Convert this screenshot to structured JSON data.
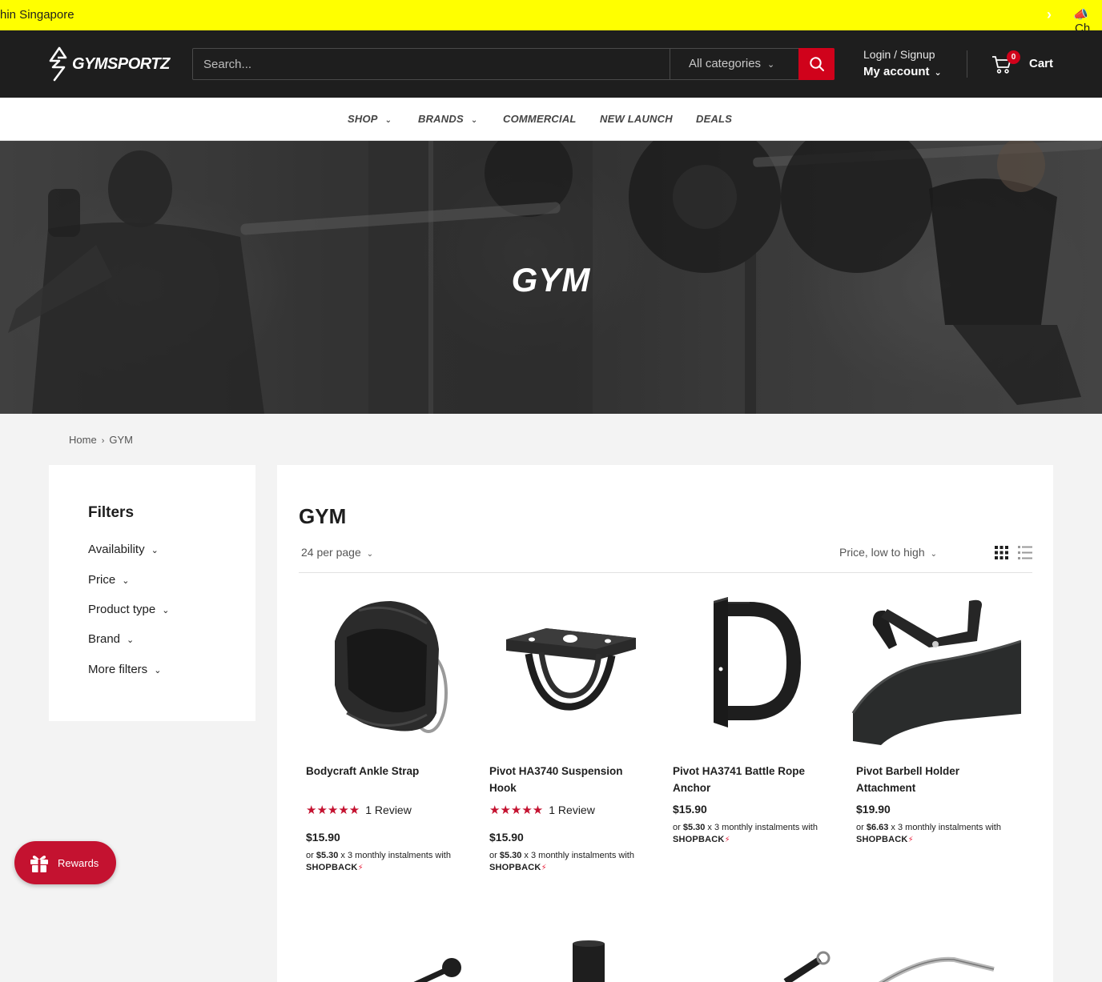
{
  "announcement": {
    "text": "hin Singapore",
    "next_label": "›",
    "right_text": "Ch"
  },
  "header": {
    "logo_text": "GYMSPORTZ",
    "search_placeholder": "Search...",
    "category_select": "All categories",
    "account_line1": "Login / Signup",
    "account_line2": "My account",
    "cart_count": "0",
    "cart_label": "Cart"
  },
  "nav": [
    {
      "label": "SHOP",
      "has_dropdown": true
    },
    {
      "label": "BRANDS",
      "has_dropdown": true
    },
    {
      "label": "COMMERCIAL",
      "has_dropdown": false
    },
    {
      "label": "NEW LAUNCH",
      "has_dropdown": false
    },
    {
      "label": "DEALS",
      "has_dropdown": false
    }
  ],
  "hero": {
    "title": "GYM"
  },
  "breadcrumb": {
    "home": "Home",
    "current": "GYM"
  },
  "filters": {
    "title": "Filters",
    "items": [
      "Availability",
      "Price",
      "Product type",
      "Brand",
      "More filters"
    ]
  },
  "collection": {
    "title": "GYM",
    "per_page": "24 per page",
    "sort": "Price, low to high"
  },
  "products": [
    {
      "name": "Bodycraft Ankle Strap",
      "rating": 5,
      "stars": "★★★★★",
      "reviews": "1 Review",
      "price": "$15.90",
      "installment_prefix": "or ",
      "installment_amount": "$5.30",
      "installment_suffix": " x 3 monthly instalments with",
      "installment_brand": "SHOPBACK"
    },
    {
      "name": "Pivot HA3740 Suspension Hook",
      "rating": 5,
      "stars": "★★★★★",
      "reviews": "1 Review",
      "price": "$15.90",
      "installment_prefix": "or ",
      "installment_amount": "$5.30",
      "installment_suffix": " x 3 monthly instalments with",
      "installment_brand": "SHOPBACK"
    },
    {
      "name": "Pivot HA3741 Battle Rope Anchor",
      "price": "$15.90",
      "installment_prefix": "or ",
      "installment_amount": "$5.30",
      "installment_suffix": " x 3 monthly instalments with",
      "installment_brand": "SHOPBACK"
    },
    {
      "name": "Pivot Barbell Holder Attachment",
      "price": "$19.90",
      "installment_prefix": "or ",
      "installment_amount": "$6.63",
      "installment_suffix": " x 3 monthly instalments with",
      "installment_brand": "SHOPBACK"
    }
  ],
  "rewards": {
    "label": "Rewards"
  },
  "colors": {
    "accent": "#d0021b",
    "announcement_bg": "#ffff00",
    "header_bg": "#1e1e1e",
    "star": "#c41230"
  }
}
